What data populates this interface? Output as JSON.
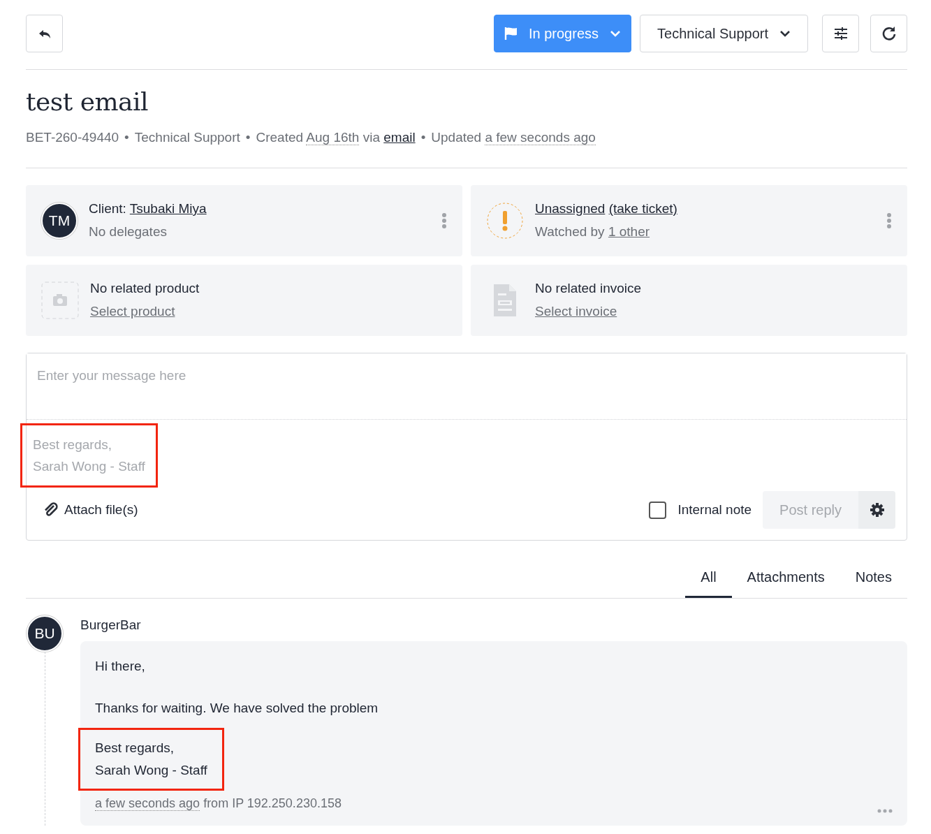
{
  "toolbar": {
    "back": {
      "kind": "back"
    },
    "status": {
      "label": "In progress"
    },
    "department": {
      "label": "Technical Support"
    },
    "tools": [
      {
        "kind": "sliders"
      },
      {
        "kind": "refresh"
      }
    ]
  },
  "ticket": {
    "title": "test email",
    "meta": [
      {
        "parts": [
          {
            "kind": "text",
            "text": "BET-260-49440"
          }
        ]
      },
      {
        "bullet": "•",
        "parts": [
          {
            "kind": "text",
            "text": "Technical Support"
          }
        ]
      },
      {
        "bullet": "•",
        "parts": [
          {
            "kind": "text",
            "text": "Created"
          },
          {
            "kind": "dotted",
            "text": "Aug 16th"
          },
          {
            "kind": "text",
            "text": "via"
          },
          {
            "kind": "link",
            "text": "email"
          }
        ]
      },
      {
        "bullet": "•",
        "parts": [
          {
            "kind": "text",
            "text": "Updated"
          },
          {
            "kind": "dotted",
            "text": "a few seconds ago"
          }
        ]
      }
    ]
  },
  "cards": [
    {
      "kind": "client",
      "avatar": "TM",
      "menu": true,
      "line1": [
        {
          "kind": "text",
          "text": "Client:"
        },
        {
          "kind": "link",
          "text": "Tsubaki Miya"
        }
      ],
      "line2": [
        {
          "kind": "text",
          "text": "No delegates"
        }
      ]
    },
    {
      "kind": "assignee",
      "menu": true,
      "line1": [
        {
          "kind": "link",
          "text": "Unassigned"
        },
        {
          "kind": "link",
          "text": "(take ticket)"
        }
      ],
      "line2": [
        {
          "kind": "text",
          "text": "Watched by"
        },
        {
          "kind": "muted-link",
          "text": "1 other"
        }
      ]
    },
    {
      "kind": "product",
      "menu": false,
      "line1": [
        {
          "kind": "text",
          "text": "No related product"
        }
      ],
      "line2": [
        {
          "kind": "muted-link",
          "text": "Select product"
        }
      ]
    },
    {
      "kind": "invoice",
      "menu": false,
      "line1": [
        {
          "kind": "text",
          "text": "No related invoice"
        }
      ],
      "line2": [
        {
          "kind": "muted-link",
          "text": "Select invoice"
        }
      ]
    }
  ],
  "composer": {
    "placeholder": "Enter your message here",
    "signature": {
      "highlighted": true,
      "lines": [
        "Best regards,",
        "Sarah Wong - Staff"
      ]
    },
    "attach": "Attach file(s)",
    "internal_note": {
      "label": "Internal note",
      "checked": false
    },
    "post": {
      "label": "Post reply",
      "disabled": true
    }
  },
  "tabs": [
    {
      "label": "All",
      "selected": true
    },
    {
      "label": "Attachments",
      "selected": false
    },
    {
      "label": "Notes",
      "selected": false
    }
  ],
  "messages": [
    {
      "avatar": "BU",
      "author": "BurgerBar",
      "paragraphs": [
        "Hi there,",
        "Thanks for waiting. We have solved the problem"
      ],
      "signature": {
        "highlighted": true,
        "lines": [
          "Best regards,",
          "Sarah Wong - Staff"
        ]
      },
      "time": "a few seconds ago",
      "source": "from IP 192.250.230.158"
    }
  ]
}
